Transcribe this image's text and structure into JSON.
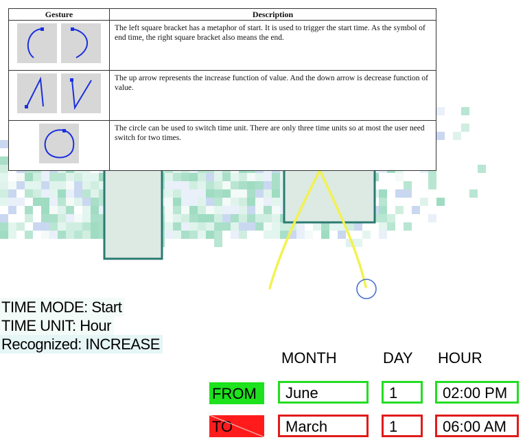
{
  "gesture_table": {
    "headers": {
      "gesture": "Gesture",
      "description": "Description"
    },
    "rows": [
      {
        "gestures": [
          "left-square-bracket-icon",
          "right-square-bracket-icon"
        ],
        "description": "The left square bracket has a metaphor of start. It is used to trigger the start time. As the symbol of end time, the right square bracket also means the end."
      },
      {
        "gestures": [
          "up-arrow-icon",
          "down-arrow-icon"
        ],
        "description": "The up arrow represents the increase function of value. And the down arrow is decrease function of value."
      },
      {
        "gestures": [
          "circle-icon"
        ],
        "description": "The circle can be used to switch time unit. There are only three time units so at most the user need switch for two times."
      }
    ]
  },
  "status": {
    "time_mode": "TIME MODE: Start",
    "time_unit": "TIME UNIT: Hour",
    "recognized": "Recognized: INCREASE"
  },
  "time_panel": {
    "columns": {
      "month": "MONTH",
      "day": "DAY",
      "hour": "HOUR"
    },
    "from": {
      "label": "FROM",
      "month": "June",
      "day": "1",
      "hour": "02:00 PM",
      "color": "#22dd22"
    },
    "to": {
      "label": "TO",
      "month": "March",
      "day": "1",
      "hour": "06:00 AM",
      "color": "#e01a1a"
    }
  },
  "colors": {
    "ink_stroke": "#f2f250",
    "cursor": "#4a6fd0",
    "gesture_ink": "#1a2fe0"
  }
}
